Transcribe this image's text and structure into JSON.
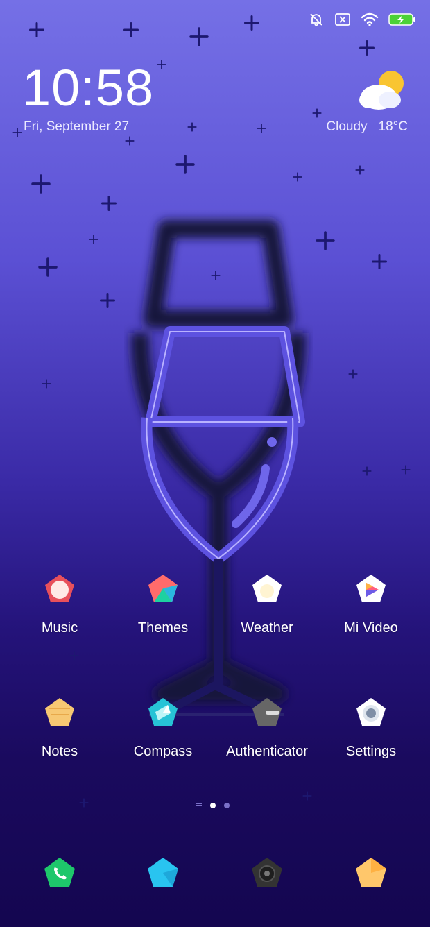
{
  "status_bar": {
    "icons": [
      "bell-off-icon",
      "sim-off-icon",
      "wifi-icon",
      "battery-charging-icon"
    ],
    "battery_color": "#4cd137"
  },
  "clock": {
    "time": "10:58",
    "date": "Fri, September 27"
  },
  "weather": {
    "condition": "Cloudy",
    "temperature": "18°C",
    "icon": "partly-cloudy-icon"
  },
  "apps": [
    {
      "label": "Music",
      "icon": "music-icon",
      "color": "#e8505b"
    },
    {
      "label": "Themes",
      "icon": "themes-icon",
      "color": "#ff6b6b"
    },
    {
      "label": "Weather",
      "icon": "weather-icon",
      "color": "#ffffff"
    },
    {
      "label": "Mi Video",
      "icon": "video-icon",
      "color": "#ffffff"
    },
    {
      "label": "Notes",
      "icon": "notes-icon",
      "color": "#f7c873"
    },
    {
      "label": "Compass",
      "icon": "compass-icon",
      "color": "#27c3d6"
    },
    {
      "label": "Authenticator",
      "icon": "authenticator-icon",
      "color": "#666666"
    },
    {
      "label": "Settings",
      "icon": "settings-icon",
      "color": "#ffffff"
    }
  ],
  "page_indicator": {
    "pages": 2,
    "current": 1
  },
  "dock": [
    {
      "icon": "phone-icon",
      "color": "#1ec76b"
    },
    {
      "icon": "messaging-icon",
      "color": "#29c4f0"
    },
    {
      "icon": "camera-icon",
      "color": "#333333"
    },
    {
      "icon": "browser-icon",
      "color": "#ffc76b"
    }
  ]
}
